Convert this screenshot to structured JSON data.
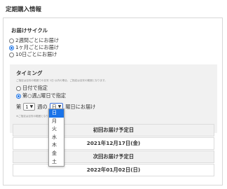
{
  "page_title": "定期購入情報",
  "delivery_cycle": {
    "title": "お届けサイクル",
    "options": [
      {
        "label": "2週間ごとにお届け",
        "checked": false
      },
      {
        "label": "1ヶ月ごとにお届け",
        "checked": true
      },
      {
        "label": "10日ごとにお届け",
        "checked": false
      }
    ]
  },
  "timing": {
    "title": "タイミング",
    "note": "ご指定は目安の範囲での目安 1日 以内の場合、ご指定は目安の範囲となります。",
    "options": [
      {
        "label": "日付で指定",
        "checked": false
      },
      {
        "label": "第○週△曜日で指定",
        "checked": true
      }
    ],
    "week_prefix": "第",
    "week_value": "1",
    "week_suffix": "週の",
    "weekday_value": "日",
    "weekday_suffix": "曜日にお届け",
    "select_note": "※ご指定は目安の範囲となります。"
  },
  "schedule": {
    "first_label": "初回お届け予定日",
    "first_date": "2021年12月17日(金)",
    "next_label": "次回お届け予定日",
    "next_date": "2022年01月02日(日)"
  },
  "weekday_dropdown": {
    "options": [
      "日",
      "月",
      "火",
      "水",
      "木",
      "金",
      "土"
    ],
    "selected": "日"
  },
  "colors": {
    "accent": "#1a73e8",
    "panel_bg": "#f1f1f1",
    "border": "#d8d8d8"
  }
}
